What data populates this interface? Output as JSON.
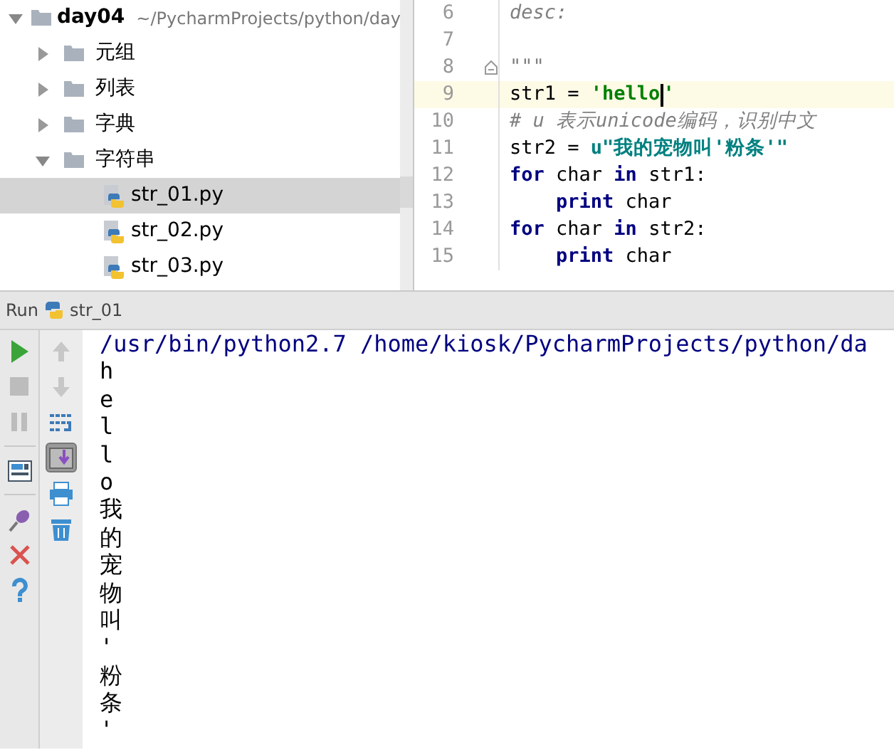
{
  "project_tree": {
    "name": "day04",
    "path": "~/PycharmProjects/python/day",
    "expanded": true,
    "children": [
      {
        "name": "元组",
        "kind": "folder",
        "expanded": false
      },
      {
        "name": "列表",
        "kind": "folder",
        "expanded": false
      },
      {
        "name": "字典",
        "kind": "folder",
        "expanded": false
      },
      {
        "name": "字符串",
        "kind": "folder",
        "expanded": true,
        "children": [
          {
            "name": "str_01.py",
            "kind": "file",
            "selected": true
          },
          {
            "name": "str_02.py",
            "kind": "file",
            "selected": false
          },
          {
            "name": "str_03.py",
            "kind": "file",
            "selected": false
          }
        ]
      }
    ]
  },
  "editor": {
    "lines": [
      {
        "number": "6",
        "current": false,
        "tokens": [
          {
            "text": "desc:",
            "kind": "docstring"
          }
        ]
      },
      {
        "number": "7",
        "current": false
      },
      {
        "number": "8",
        "current": false,
        "fold": true,
        "tokens": [
          {
            "text": "\"\"\"",
            "kind": "docstring"
          }
        ]
      },
      {
        "number": "9",
        "current": true,
        "tokens": [
          {
            "text": "str1 = ",
            "kind": "plain"
          },
          {
            "text": "'hello",
            "kind": "string",
            "caret_after": true
          },
          {
            "text": "'",
            "kind": "string"
          }
        ]
      },
      {
        "number": "10",
        "current": false,
        "tokens": [
          {
            "text": "# u 表示unicode编码，识别中文",
            "kind": "comment"
          }
        ]
      },
      {
        "number": "11",
        "current": false,
        "tokens": [
          {
            "text": "str2 = ",
            "kind": "plain"
          },
          {
            "text": "u\"我的宠物叫'粉条'\"",
            "kind": "ustring"
          }
        ]
      },
      {
        "number": "12",
        "current": false,
        "tokens": [
          {
            "text": "for",
            "kind": "keyword"
          },
          {
            "text": " char ",
            "kind": "plain"
          },
          {
            "text": "in",
            "kind": "keyword"
          },
          {
            "text": " str1:",
            "kind": "plain"
          }
        ]
      },
      {
        "number": "13",
        "current": false,
        "tokens": [
          {
            "text": "    print",
            "kind": "keyword"
          },
          {
            "text": " char",
            "kind": "plain"
          }
        ]
      },
      {
        "number": "14",
        "current": false,
        "tokens": [
          {
            "text": "for",
            "kind": "keyword"
          },
          {
            "text": " char ",
            "kind": "plain"
          },
          {
            "text": "in",
            "kind": "keyword"
          },
          {
            "text": " str2:",
            "kind": "plain"
          }
        ]
      },
      {
        "number": "15",
        "current": false,
        "tokens": [
          {
            "text": "    print",
            "kind": "keyword"
          },
          {
            "text": " char",
            "kind": "plain"
          }
        ]
      }
    ]
  },
  "run_panel": {
    "label": "Run",
    "config": "str_01",
    "left_tools": [
      {
        "kind": "run",
        "disabled": false
      },
      {
        "kind": "stop",
        "disabled": true
      },
      {
        "kind": "pause",
        "disabled": true
      },
      {
        "kind": "sep"
      },
      {
        "kind": "layout",
        "disabled": false
      },
      {
        "kind": "sep"
      },
      {
        "kind": "pin",
        "disabled": false
      },
      {
        "kind": "close",
        "disabled": false
      },
      {
        "kind": "help",
        "disabled": false
      }
    ],
    "right_tools": [
      {
        "kind": "up",
        "disabled": true
      },
      {
        "kind": "down",
        "disabled": true
      },
      {
        "kind": "wrap",
        "selected": false
      },
      {
        "kind": "scroll-end",
        "selected": true
      },
      {
        "kind": "print",
        "selected": false
      },
      {
        "kind": "trash",
        "selected": false
      }
    ],
    "console": [
      {
        "text": "/usr/bin/python2.7 /home/kiosk/PycharmProjects/python/da",
        "kind": "command"
      },
      {
        "text": "h",
        "kind": "output"
      },
      {
        "text": "e",
        "kind": "output"
      },
      {
        "text": "l",
        "kind": "output"
      },
      {
        "text": "l",
        "kind": "output"
      },
      {
        "text": "o",
        "kind": "output"
      },
      {
        "text": "我",
        "kind": "output"
      },
      {
        "text": "的",
        "kind": "output"
      },
      {
        "text": "宠",
        "kind": "output"
      },
      {
        "text": "物",
        "kind": "output"
      },
      {
        "text": "叫",
        "kind": "output"
      },
      {
        "text": "'",
        "kind": "output"
      },
      {
        "text": "粉",
        "kind": "output"
      },
      {
        "text": "条",
        "kind": "output"
      },
      {
        "text": "'",
        "kind": "output"
      }
    ]
  }
}
